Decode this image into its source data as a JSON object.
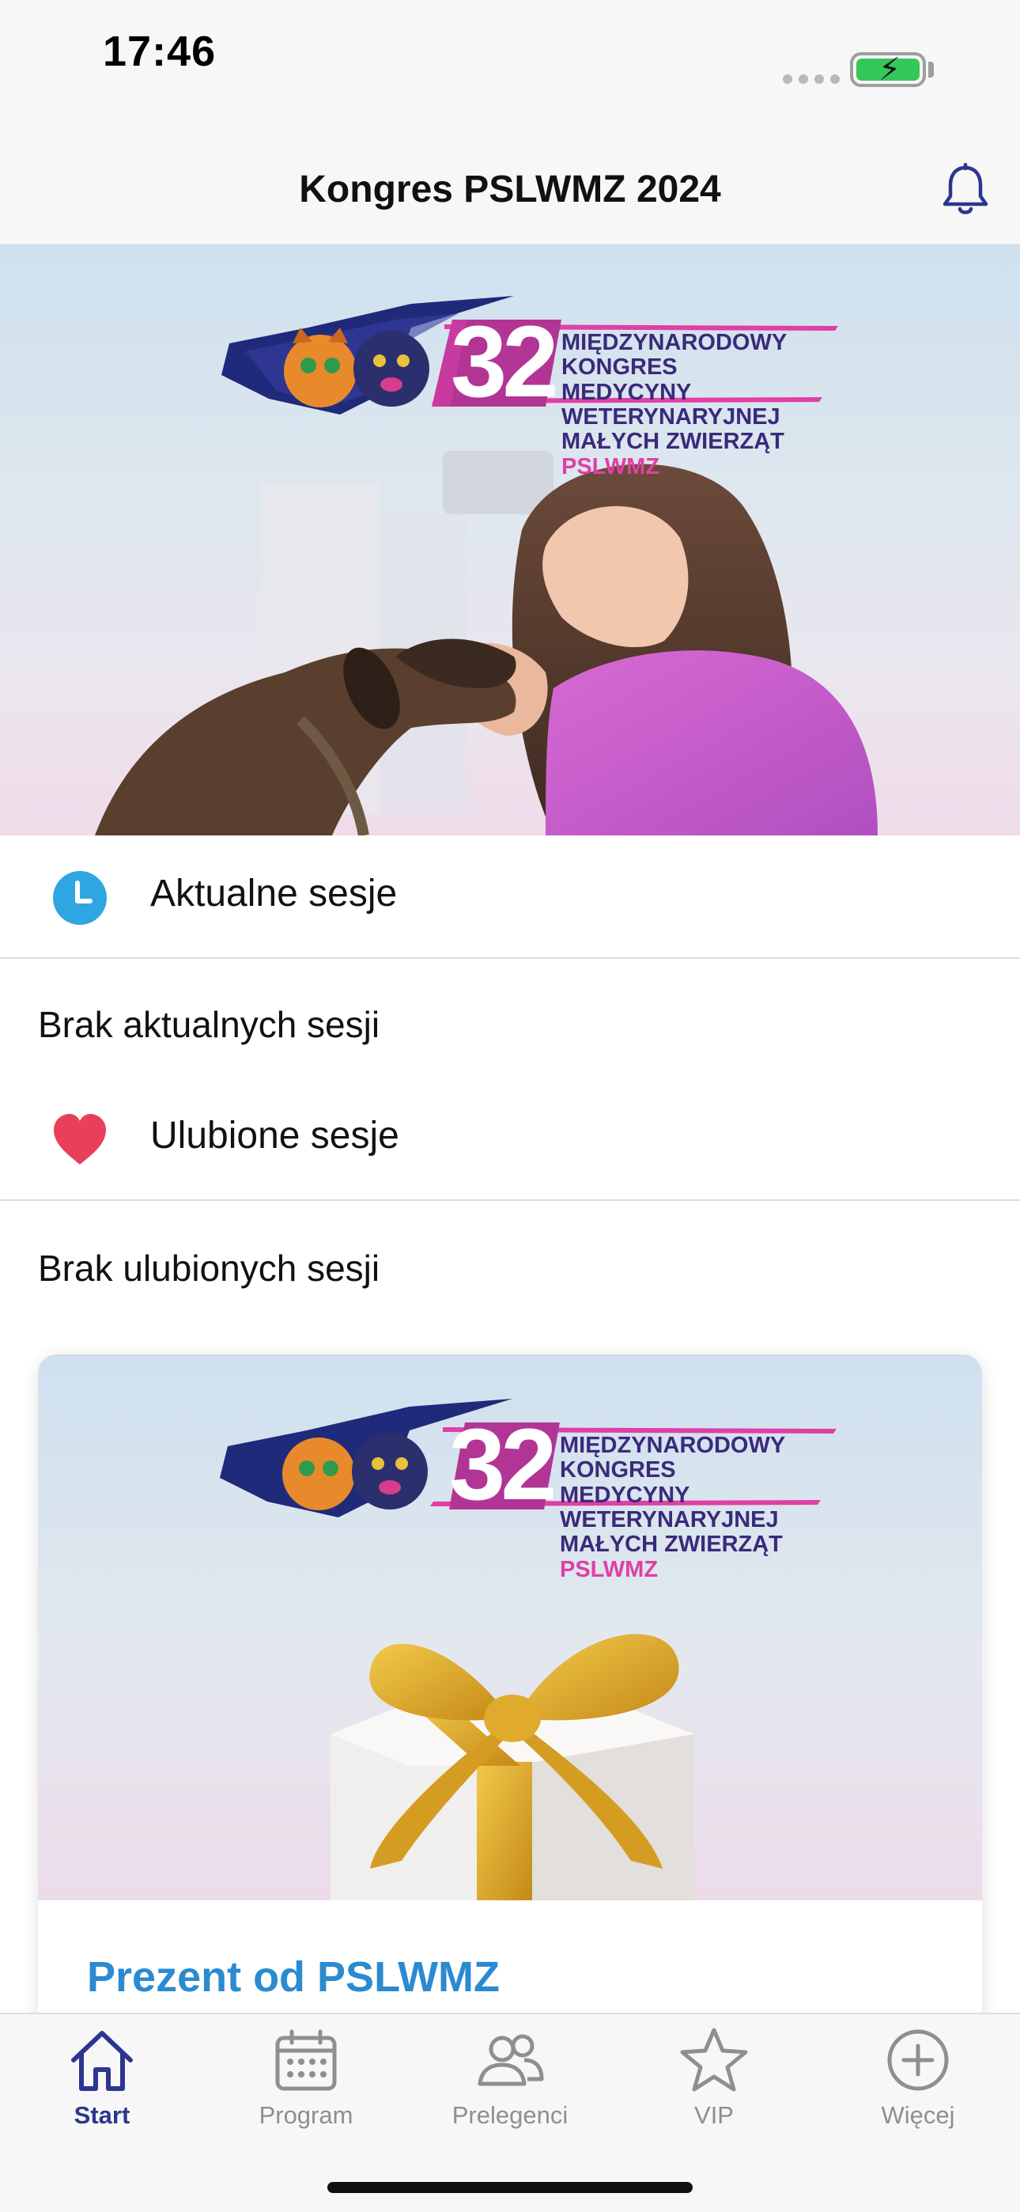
{
  "status_bar": {
    "time": "17:46"
  },
  "nav": {
    "title": "Kongres PSLWMZ 2024",
    "notification_icon": "bell-icon"
  },
  "hero": {
    "logo_number": "32",
    "logo_line1": "MIĘDZYNARODOWY KONGRES",
    "logo_line2": "MEDYCYNY WETERYNARYJNEJ",
    "logo_line3": "MAŁYCH ZWIERZĄT",
    "logo_highlight": "PSLWMZ"
  },
  "sections": {
    "current": {
      "title": "Aktualne sesje",
      "icon": "clock-icon",
      "empty": "Brak aktualnych sesji"
    },
    "favorites": {
      "title": "Ulubione sesje",
      "icon": "heart-icon",
      "empty": "Brak ulubionych sesji"
    }
  },
  "card": {
    "title": "Prezent od PSLWMZ",
    "logo_number": "32",
    "logo_line1": "MIĘDZYNARODOWY KONGRES",
    "logo_line2": "MEDYCYNY WETERYNARYJNEJ",
    "logo_line3": "MAŁYCH ZWIERZĄT",
    "logo_highlight": "PSLWMZ"
  },
  "tabs": [
    {
      "label": "Start",
      "icon": "home-icon",
      "active": true
    },
    {
      "label": "Program",
      "icon": "calendar-icon",
      "active": false
    },
    {
      "label": "Prelegenci",
      "icon": "people-icon",
      "active": false
    },
    {
      "label": "VIP",
      "icon": "star-icon",
      "active": false
    },
    {
      "label": "Więcej",
      "icon": "plus-circle-icon",
      "active": false
    }
  ],
  "colors": {
    "accent": "#2c3590",
    "link": "#2b8ad0",
    "clock": "#2ea6e2",
    "heart": "#e8405a",
    "logo_purple": "#3a2a7a",
    "logo_pink": "#e03fa6"
  }
}
